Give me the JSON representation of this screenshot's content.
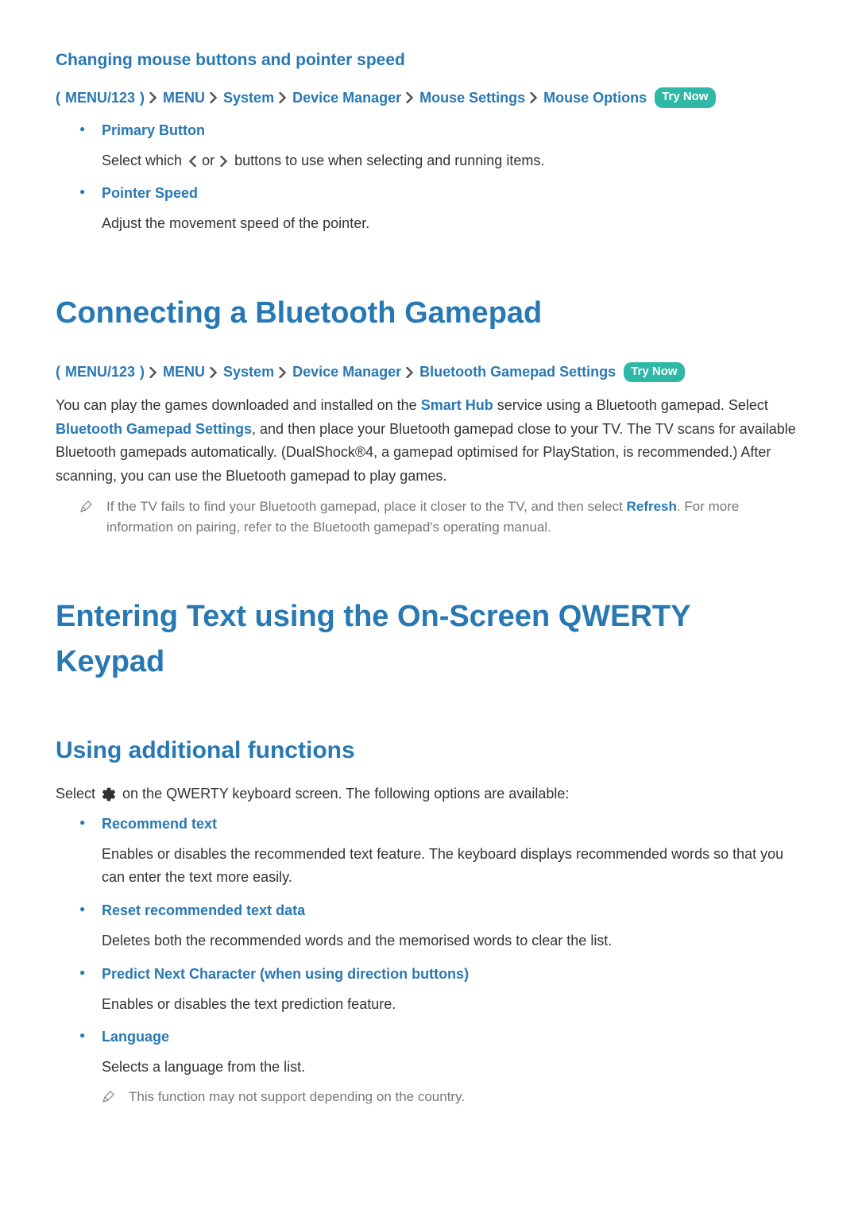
{
  "section1": {
    "title": "Changing mouse buttons and pointer speed",
    "breadcrumb": {
      "paren_open": "(",
      "paren_close": ")",
      "items": [
        "MENU/123",
        "MENU",
        "System",
        "Device Manager",
        "Mouse Settings",
        "Mouse Options"
      ],
      "try_now": "Try Now"
    },
    "features": [
      {
        "title": "Primary Button",
        "desc_pre": "Select which ",
        "desc_mid": " or ",
        "desc_post": " buttons to use when selecting and running items."
      },
      {
        "title": "Pointer Speed",
        "desc": "Adjust the movement speed of the pointer."
      }
    ]
  },
  "section2": {
    "title": "Connecting a Bluetooth Gamepad",
    "breadcrumb": {
      "paren_open": "(",
      "paren_close": ")",
      "items": [
        "MENU/123",
        "MENU",
        "System",
        "Device Manager",
        "Bluetooth Gamepad Settings"
      ],
      "try_now": "Try Now"
    },
    "body_p1a": "You can play the games downloaded and installed on the ",
    "body_p1_link1": "Smart Hub",
    "body_p1b": " service using a Bluetooth gamepad. Select ",
    "body_p1_link2": "Bluetooth Gamepad Settings",
    "body_p1c": ", and then place your Bluetooth gamepad close to your TV. The TV scans for available Bluetooth gamepads automatically. (DualShock®4, a gamepad optimised for PlayStation, is recommended.) After scanning, you can use the Bluetooth gamepad to play games.",
    "note_a": "If the TV fails to find your Bluetooth gamepad, place it closer to the TV, and then select ",
    "note_link": "Refresh",
    "note_b": ". For more information on pairing, refer to the Bluetooth gamepad's operating manual."
  },
  "section3": {
    "title": "Entering Text using the On-Screen QWERTY Keypad",
    "sub_title": "Using additional functions",
    "intro_a": "Select ",
    "intro_b": " on the QWERTY keyboard screen. The following options are available:",
    "features": [
      {
        "title": "Recommend text",
        "desc": "Enables or disables the recommended text feature. The keyboard displays recommended words so that you can enter the text more easily."
      },
      {
        "title": "Reset recommended text data",
        "desc": "Deletes both the recommended words and the memorised words to clear the list."
      },
      {
        "title": "Predict Next Character (when using direction buttons)",
        "desc": "Enables or disables the text prediction feature."
      },
      {
        "title": "Language",
        "desc": "Selects a language from the list.",
        "note": "This function may not support depending on the country."
      }
    ]
  }
}
